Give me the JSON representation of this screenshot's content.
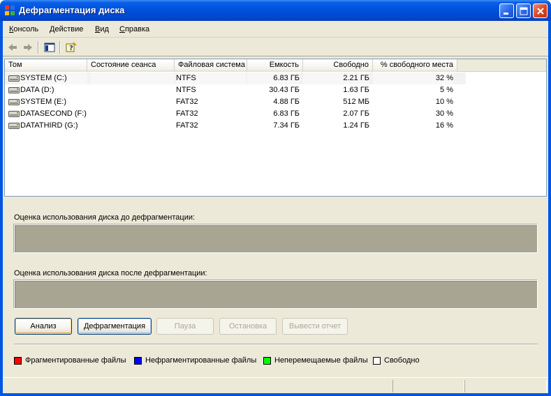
{
  "window": {
    "title": "Дефрагментация диска"
  },
  "menu": [
    {
      "text": "Консоль",
      "accel": "К",
      "rest": "онсоль"
    },
    {
      "text": "Действие",
      "accel": "Д",
      "rest": "ействие"
    },
    {
      "text": "Вид",
      "accel": "В",
      "rest": "ид"
    },
    {
      "text": "Справка",
      "accel": "С",
      "rest": "правка"
    }
  ],
  "columns": [
    "Том",
    "Состояние сеанса",
    "Файловая система",
    "Емкость",
    "Свободно",
    "% свободного места"
  ],
  "volumes": [
    {
      "name": "SYSTEM (C:)",
      "status": "",
      "fs": "NTFS",
      "capacity": "6.83 ГБ",
      "free": "2.21 ГБ",
      "pct": "32 %"
    },
    {
      "name": "DATA (D:)",
      "status": "",
      "fs": "NTFS",
      "capacity": "30.43 ГБ",
      "free": "1.63 ГБ",
      "pct": "5 %"
    },
    {
      "name": "SYSTEM (E:)",
      "status": "",
      "fs": "FAT32",
      "capacity": "4.88 ГБ",
      "free": "512 МБ",
      "pct": "10 %"
    },
    {
      "name": "DATASECOND (F:)",
      "status": "",
      "fs": "FAT32",
      "capacity": "6.83 ГБ",
      "free": "2.07 ГБ",
      "pct": "30 %"
    },
    {
      "name": "DATATHIRD (G:)",
      "status": "",
      "fs": "FAT32",
      "capacity": "7.34 ГБ",
      "free": "1.24 ГБ",
      "pct": "16 %"
    }
  ],
  "analysis": {
    "before_label": "Оценка использования диска до дефрагментации:",
    "after_label": "Оценка использования диска после дефрагментации:"
  },
  "buttons": {
    "analyze": "Анализ",
    "defrag": "Дефрагментация",
    "pause": "Пауза",
    "stop": "Остановка",
    "report": "Вывести отчет"
  },
  "legend": [
    {
      "label": "Фрагментированные файлы",
      "color": "#ff0000"
    },
    {
      "label": "Нефрагментированные файлы",
      "color": "#0000ff"
    },
    {
      "label": "Неперемещаемые файлы",
      "color": "#00ff00"
    },
    {
      "label": "Свободно",
      "color": "#ffffff"
    }
  ]
}
